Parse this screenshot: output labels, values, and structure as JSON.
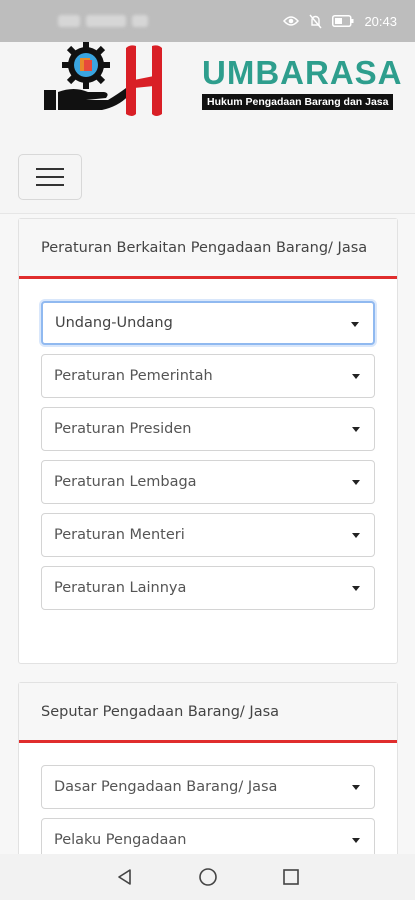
{
  "status_bar": {
    "time": "20:43"
  },
  "header": {
    "brand_name": "UMBARASA",
    "tagline": "Hukum Pengadaan Barang dan Jasa"
  },
  "sections": [
    {
      "title": "Peraturan Berkaitan Pengadaan Barang/ Jasa",
      "selects": [
        {
          "value": "Undang-Undang"
        },
        {
          "value": "Peraturan Pemerintah"
        },
        {
          "value": "Peraturan Presiden"
        },
        {
          "value": "Peraturan Lembaga"
        },
        {
          "value": "Peraturan Menteri"
        },
        {
          "value": "Peraturan Lainnya"
        }
      ]
    },
    {
      "title": "Seputar Pengadaan Barang/ Jasa",
      "selects": [
        {
          "value": "Dasar Pengadaan Barang/ Jasa"
        },
        {
          "value": "Pelaku Pengadaan"
        }
      ]
    }
  ],
  "colors": {
    "brand_teal": "#2e9e8d",
    "brand_red": "#d91f26",
    "accent_red": "#e02d2d",
    "focus_blue": "#90b9f0"
  }
}
